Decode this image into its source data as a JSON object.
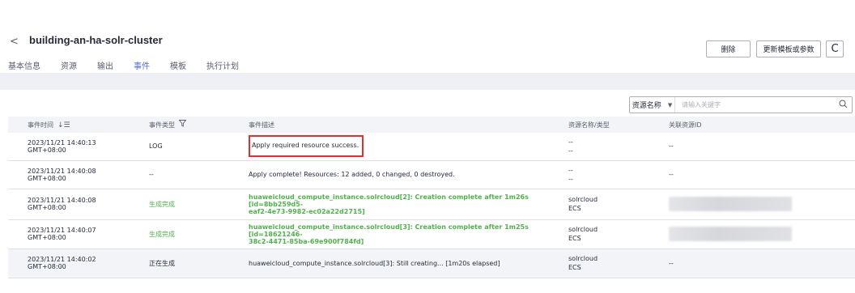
{
  "header": {
    "back_glyph": "<",
    "title": "building-an-ha-solr-cluster",
    "tabs": [
      {
        "label": "基本信息",
        "active": false
      },
      {
        "label": "资源",
        "active": false
      },
      {
        "label": "输出",
        "active": false
      },
      {
        "label": "事件",
        "active": true
      },
      {
        "label": "模板",
        "active": false
      },
      {
        "label": "执行计划",
        "active": false
      }
    ],
    "delete_label": "删除",
    "update_label": "更新模板或参数",
    "refresh_glyph": "C"
  },
  "filter": {
    "select_label": "资源名称",
    "placeholder": "请输入关键字"
  },
  "table": {
    "headers": {
      "time": "事件时间",
      "type": "事件类型",
      "desc": "事件描述",
      "resource": "资源名称/类型",
      "related": "关联资源ID"
    },
    "rows": [
      {
        "time": "2023/11/21 14:40:13 GMT+08:00",
        "type": "LOG",
        "desc": "Apply required resource success.",
        "res_name": "--",
        "res_type": "--",
        "related": "--"
      },
      {
        "time": "2023/11/21 14:40:08 GMT+08:00",
        "type": "--",
        "desc": "Apply complete! Resources: 12 added, 0 changed, 0 destroyed.",
        "res_name": "--",
        "res_type": "--",
        "related": "--"
      },
      {
        "time": "2023/11/21 14:40:08 GMT+08:00",
        "type": "生成完成",
        "desc_line1": "huaweicloud_compute_instance.solrcloud[2]: Creation complete after 1m26s [id=8bb259d5-",
        "desc_line2": "eaf2-4e73-9982-ec02a22d2715]",
        "res_name": "solrcloud",
        "res_type": "ECS"
      },
      {
        "time": "2023/11/21 14:40:07 GMT+08:00",
        "type": "生成完成",
        "desc_line1": "huaweicloud_compute_instance.solrcloud[3]: Creation complete after 1m25s [id=18621246-",
        "desc_line2": "38c2-4471-85ba-69e900f784fd]",
        "res_name": "solrcloud",
        "res_type": "ECS"
      },
      {
        "time": "2023/11/21 14:40:02 GMT+08:00",
        "type": "正在生成",
        "desc": "huaweicloud_compute_instance.solrcloud[3]: Still creating... [1m20s elapsed]",
        "res_name": "solrcloud",
        "res_type": "ECS",
        "related": "--"
      }
    ]
  },
  "colors": {
    "accent": "#526ecc",
    "success": "#50b14c",
    "highlight_box": "#e62e2e"
  }
}
